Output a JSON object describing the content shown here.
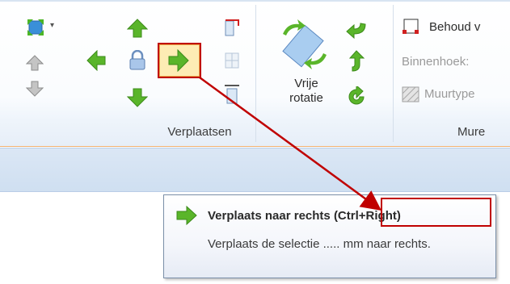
{
  "ribbon": {
    "groups": {
      "move_label": "Verplaatsen",
      "walls_label": "Mure"
    },
    "rotate": {
      "free_rotation_label_line1": "Vrije",
      "free_rotation_label_line2": "rotatie"
    },
    "walls": {
      "keep_label": "Behoud v",
      "inner_angle_label": "Binnenhoek:",
      "wall_type_label": "Muurtype"
    }
  },
  "tooltip": {
    "title": "Verplaats naar rechts",
    "shortcut": "(Ctrl+Right)",
    "description": "Verplaats de selectie ..... mm naar rechts."
  },
  "colors": {
    "arrow_green": "#5ab52a",
    "highlight_red": "#c00000",
    "bar_blue": "#d4e3f3"
  }
}
